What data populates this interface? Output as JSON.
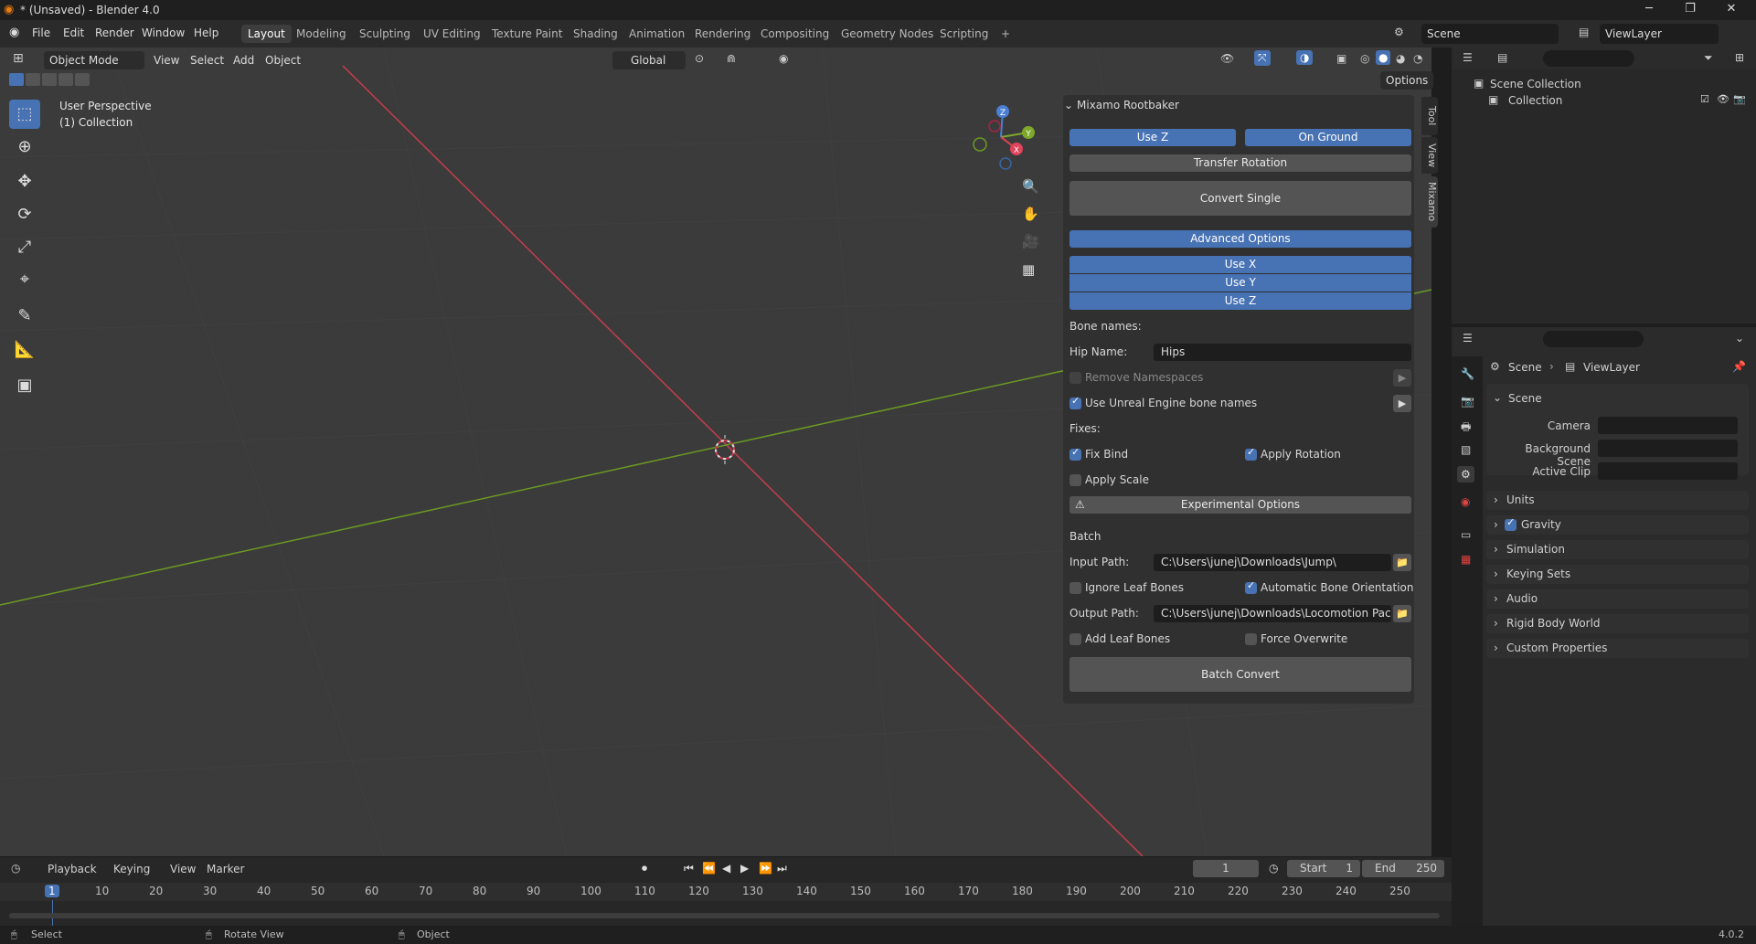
{
  "window": {
    "title": "* (Unsaved) - Blender 4.0",
    "minimize": "─",
    "maximize": "❐",
    "close": "✕"
  },
  "menu": [
    "File",
    "Edit",
    "Render",
    "Window",
    "Help"
  ],
  "workspaces": [
    "Layout",
    "Modeling",
    "Sculpting",
    "UV Editing",
    "Texture Paint",
    "Shading",
    "Animation",
    "Rendering",
    "Compositing",
    "Geometry Nodes",
    "Scripting",
    "+"
  ],
  "scene": {
    "name": "Scene",
    "viewlayer": "ViewLayer"
  },
  "viewport_header": {
    "mode": "Object Mode",
    "menus": [
      "View",
      "Select",
      "Add",
      "Object"
    ],
    "transform_orientation": "Global",
    "options": "Options"
  },
  "viewport_info": {
    "perspective": "User Perspective",
    "collection": "(1) Collection"
  },
  "gizmo": {
    "z": "Z",
    "y": "Y",
    "x": "X"
  },
  "side_tabs": [
    "Tool",
    "View",
    "Mixamo"
  ],
  "npanel": {
    "title": "Mixamo Rootbaker",
    "use_z": "Use Z",
    "on_ground": "On Ground",
    "transfer_rotation": "Transfer Rotation",
    "convert_single": "Convert Single",
    "advanced_options": "Advanced Options",
    "adv_use_x": "Use X",
    "adv_use_y": "Use Y",
    "adv_use_z": "Use Z",
    "bone_names_label": "Bone names:",
    "hip_name_label": "Hip Name:",
    "hip_name_value": "Hips",
    "remove_namespaces": "Remove Namespaces",
    "use_unreal": "Use Unreal Engine bone names",
    "fixes_label": "Fixes:",
    "fix_bind": "Fix Bind",
    "apply_rotation": "Apply Rotation",
    "apply_scale": "Apply Scale",
    "experimental_options": "Experimental Options",
    "batch_label": "Batch",
    "input_path_label": "Input Path:",
    "input_path_value": "C:\\Users\\junej\\Downloads\\Jump\\",
    "ignore_leaf_bones": "Ignore Leaf Bones",
    "automatic_bone_orientation": "Automatic Bone Orientation",
    "output_path_label": "Output Path:",
    "output_path_value": "C:\\Users\\junej\\Downloads\\Locomotion Pack\\...",
    "add_leaf_bones": "Add Leaf Bones",
    "force_overwrite": "Force Overwrite",
    "batch_convert": "Batch Convert"
  },
  "outliner": {
    "root": "Scene Collection",
    "child": "Collection"
  },
  "properties": {
    "breadcrumb_scene": "Scene",
    "breadcrumb_viewlayer": "ViewLayer",
    "section_scene": "Scene",
    "camera_label": "Camera",
    "background_scene_label": "Background Scene",
    "active_clip_label": "Active Clip",
    "panels": [
      "Units",
      "Gravity",
      "Simulation",
      "Keying Sets",
      "Audio",
      "Rigid Body World",
      "Custom Properties"
    ]
  },
  "timeline": {
    "menus": [
      "Playback",
      "Keying",
      "View",
      "Marker"
    ],
    "current_frame": "1",
    "start_label": "Start",
    "start_value": "1",
    "end_label": "End",
    "end_value": "250",
    "ruler": [
      "1",
      "10",
      "20",
      "30",
      "40",
      "50",
      "60",
      "70",
      "80",
      "90",
      "100",
      "110",
      "120",
      "130",
      "140",
      "150",
      "160",
      "170",
      "180",
      "190",
      "200",
      "210",
      "220",
      "230",
      "240",
      "250"
    ]
  },
  "statusbar": {
    "select": "Select",
    "rotate_view": "Rotate View",
    "object": "Object",
    "version": "4.0.2"
  },
  "colors": {
    "accent": "#4772b3",
    "x_axis": "#c53d4c",
    "y_axis": "#6b9a22"
  }
}
